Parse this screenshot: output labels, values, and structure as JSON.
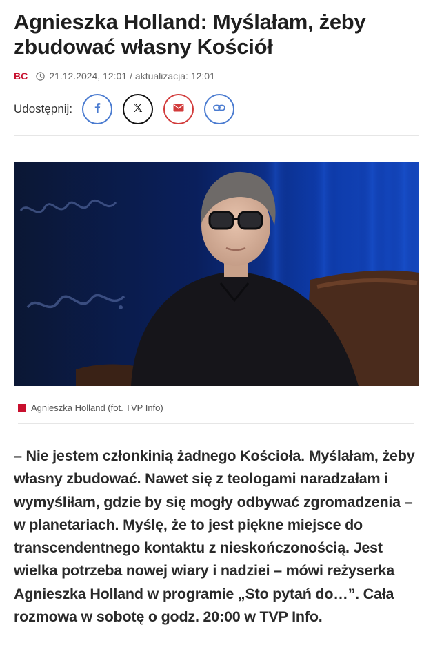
{
  "article": {
    "title": "Agnieszka Holland: Myślałam, żeby zbudować własny Kościół",
    "author": "BC",
    "published": "21.12.2024, 12:01",
    "updated_label": "/ aktualizacja: 12:01",
    "share_label": "Udostępnij:",
    "share_buttons": [
      {
        "name": "facebook",
        "icon": "facebook-icon"
      },
      {
        "name": "x",
        "icon": "x-icon"
      },
      {
        "name": "email",
        "icon": "envelope-icon"
      },
      {
        "name": "copy-link",
        "icon": "link-icon"
      }
    ],
    "caption": "Agnieszka Holland (fot. TVP Info)",
    "lead": "– Nie jestem członkinią żadnego Kościoła. Myślałam, żeby własny zbudować. Nawet się z teologami naradzałam i wymyśliłam, gdzie by się mogły odbywać zgromadzenia – w planetariach. Myślę, że to jest piękne miejsce do transcendentnego kontaktu z nieskończonością. Jest wielka potrzeba nowej wiary i nadziei – mówi reżyserka Agnieszka Holland w programie „Sto pytań do…”. Cała rozmowa w sobotę o godz. 20:00 w TVP Info."
  },
  "colors": {
    "accent": "#c8102e",
    "facebook": "#4a7bd0",
    "email": "#d23b3b",
    "text": "#1f1f1f",
    "meta": "#666666"
  }
}
